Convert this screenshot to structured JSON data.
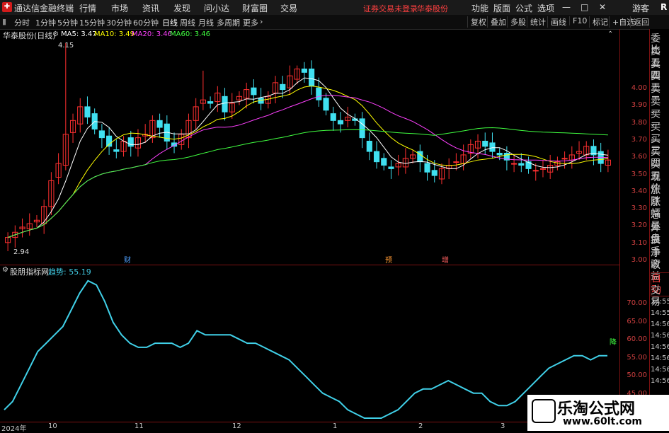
{
  "titlebar": {
    "app_title": "通达信金融终端",
    "menus": [
      "行情",
      "市场",
      "资讯",
      "发现",
      "问小达",
      "财富圈",
      "交易"
    ],
    "warning": "证券交易未登录",
    "stock_name": "华泰股份",
    "right_menus": [
      "功能",
      "版面",
      "公式",
      "选项"
    ],
    "window_buttons": [
      "—",
      "□",
      "✕"
    ],
    "guest": "游客",
    "r_icon": "R"
  },
  "toolbar": {
    "periods": [
      "分时",
      "1分钟",
      "5分钟",
      "15分钟",
      "30分钟",
      "60分钟",
      "日线",
      "周线",
      "月线",
      "多周期",
      "更多"
    ],
    "active": "日线",
    "buttons": [
      "复权",
      "叠加",
      "多股",
      "统计",
      "画线",
      "F10",
      "标记",
      "+自选",
      "返回"
    ]
  },
  "main": {
    "title": "华泰股份(日线)",
    "ma": [
      {
        "label": "MA5: 3.47",
        "color": "#ffffff"
      },
      {
        "label": "MA10: 3.49",
        "color": "#ffff00"
      },
      {
        "label": "MA20: 3.46",
        "color": "#ff40ff"
      },
      {
        "label": "MA60: 3.46",
        "color": "#40ff40"
      }
    ],
    "high_label": "4.15",
    "low_label": "2.94",
    "events": [
      "财",
      "预",
      "增"
    ],
    "price_ticks": [
      "4.00",
      "3.90",
      "3.80",
      "3.70",
      "3.60",
      "3.50",
      "3.40",
      "3.30",
      "3.20",
      "3.10",
      "3.00"
    ]
  },
  "indicator": {
    "name": "股朋指标网",
    "param_label": "趋势: 55.19",
    "end_label": "降",
    "ticks": [
      "70.00",
      "65.00",
      "60.00",
      "55.00",
      "50.00",
      "45.00"
    ]
  },
  "dates": [
    "2024年",
    "10",
    "11",
    "12",
    "1",
    "2",
    "3"
  ],
  "right_panel": {
    "items": [
      "委比",
      "卖五",
      "卖四",
      "卖三",
      "卖二",
      "卖一",
      "买一",
      "买二",
      "买三",
      "买四",
      "买五",
      "现价",
      "涨跌",
      "涨幅",
      "总量",
      "外盘",
      "换手",
      "净资",
      "收益"
    ],
    "tab": "自动",
    "tab2": "交易",
    "times": [
      "14:55",
      "14:55",
      "14:56",
      "14:56",
      "14:56",
      "14:56",
      "14:56",
      "14:56"
    ]
  },
  "watermark": {
    "title": "乐淘公式网",
    "url": "www.60lt.com"
  },
  "chart_data": [
    {
      "type": "candlestick",
      "ylim": [
        2.94,
        4.15
      ],
      "close": [
        3.02,
        3.05,
        3.08,
        3.1,
        3.12,
        3.2,
        3.35,
        3.45,
        3.62,
        3.7,
        3.78,
        3.72,
        3.65,
        3.6,
        3.55,
        3.52,
        3.58,
        3.55,
        3.6,
        3.62,
        3.7,
        3.66,
        3.58,
        3.55,
        3.62,
        3.7,
        3.78,
        3.82,
        3.8,
        3.86,
        3.75,
        3.8,
        3.84,
        3.88,
        3.85,
        3.8,
        3.84,
        3.92,
        3.88,
        3.96,
        4.0,
        3.98,
        3.9,
        3.82,
        3.76,
        3.7,
        3.68,
        3.72,
        3.7,
        3.6,
        3.52,
        3.46,
        3.44,
        3.42,
        3.45,
        3.48,
        3.5,
        3.46,
        3.4,
        3.38,
        3.42,
        3.44,
        3.46,
        3.5,
        3.56,
        3.58,
        3.55,
        3.52,
        3.5,
        3.47,
        3.45,
        3.44,
        3.42,
        3.41,
        3.42,
        3.44,
        3.46,
        3.48,
        3.5,
        3.52,
        3.55,
        3.5,
        3.45,
        3.47
      ]
    },
    {
      "type": "line",
      "name": "趋势",
      "ylim": [
        40,
        75
      ],
      "values": [
        42,
        44,
        48,
        52,
        56,
        58,
        60,
        62,
        66,
        70,
        73,
        72,
        68,
        63,
        60,
        58,
        57,
        57,
        58,
        58,
        58,
        57,
        58,
        61,
        60,
        60,
        60,
        60,
        59,
        58,
        58,
        57,
        56,
        55,
        54,
        52,
        50,
        48,
        46,
        45,
        44,
        42,
        41,
        40,
        40,
        40,
        41,
        42,
        44,
        46,
        47,
        47,
        48,
        49,
        48,
        47,
        46,
        46,
        44,
        43,
        43,
        44,
        46,
        48,
        50,
        52,
        53,
        54,
        55,
        55,
        54,
        55,
        55
      ]
    }
  ]
}
